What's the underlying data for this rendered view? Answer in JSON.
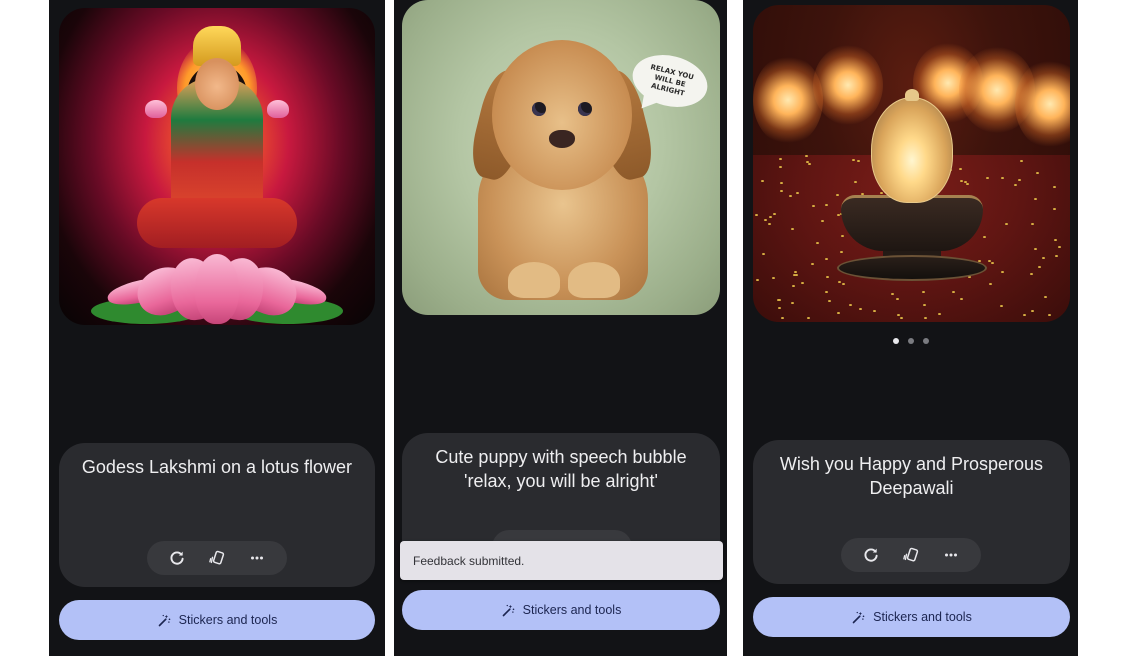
{
  "panels": [
    {
      "id": "lakshmi",
      "image_alt": "Goddess Lakshmi seated on a pink lotus flower",
      "prompt": "Godess Lakshmi on a lotus flower",
      "actions": [
        {
          "name": "regenerate",
          "icon": "refresh-icon"
        },
        {
          "name": "feedback",
          "icon": "cards-icon"
        },
        {
          "name": "more",
          "icon": "more-horizontal-icon"
        }
      ],
      "stickers_label": "Stickers and tools"
    },
    {
      "id": "puppy",
      "image_alt": "Cute golden puppy with a speech bubble",
      "bubble_text": "RELAX YOU WILL BE ALRIGHT",
      "prompt": "Cute puppy with speech bubble 'relax, you will be alright'",
      "toast": "Feedback submitted.",
      "stickers_label": "Stickers and tools"
    },
    {
      "id": "deepawali",
      "image_alt": "Ornate crystal diya lamp on red cloth with glowing lamps behind",
      "carousel": {
        "count": 3,
        "active_index": 0
      },
      "prompt": "Wish you Happy and Prosperous Deepawali",
      "actions": [
        {
          "name": "regenerate",
          "icon": "refresh-icon"
        },
        {
          "name": "feedback",
          "icon": "cards-icon"
        },
        {
          "name": "more",
          "icon": "more-horizontal-icon"
        }
      ],
      "stickers_label": "Stickers and tools"
    }
  ],
  "colors": {
    "screen_bg": "#121316",
    "card_bg": "#2a2b2f",
    "action_pill_bg": "#38393d",
    "stickers_button_bg": "#b3c1f7",
    "stickers_text": "#1c2550",
    "toast_bg": "#e4e2e8"
  }
}
